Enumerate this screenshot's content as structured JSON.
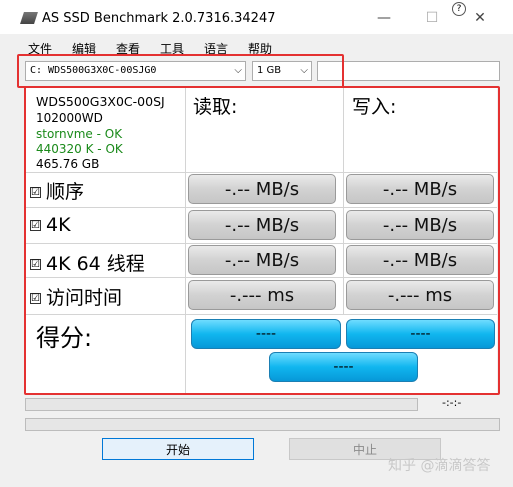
{
  "window": {
    "title": "AS SSD Benchmark 2.0.7316.34247",
    "help_glyph": "?",
    "minimize": "—",
    "maximize": "☐",
    "close": "✕"
  },
  "menu": [
    "文件",
    "编辑",
    "查看",
    "工具",
    "语言",
    "帮助"
  ],
  "toolbar": {
    "drive": "C: WDS500G3X0C-00SJG0",
    "size": "1 GB",
    "extra": ""
  },
  "drive_info": {
    "model": "WDS500G3X0C-00SJ",
    "firmware": "102000WD",
    "driver": "stornvme - OK",
    "alignment": "440320 K - OK",
    "capacity": "465.76 GB",
    "status_color": "#1a8a1a"
  },
  "columns": {
    "read": "读取:",
    "write": "写入:"
  },
  "tests": [
    {
      "label": "顺序",
      "checked": "☑",
      "read": "-.-- MB/s",
      "write": "-.-- MB/s"
    },
    {
      "label": "4K",
      "checked": "☑",
      "read": "-.-- MB/s",
      "write": "-.-- MB/s"
    },
    {
      "label": "4K 64 线程",
      "checked": "☑",
      "read": "-.-- MB/s",
      "write": "-.-- MB/s"
    },
    {
      "label": "访问时间",
      "checked": "☑",
      "read": "-.--- ms",
      "write": "-.--- ms"
    }
  ],
  "score": {
    "label": "得分:",
    "read": "----",
    "write": "----",
    "total": "----"
  },
  "progress": {
    "time": "-:-:-",
    "value": 0
  },
  "buttons": {
    "start": "开始",
    "stop": "中止"
  },
  "watermark": "知乎 @滴滴答答",
  "colors": {
    "highlight": "#e43131",
    "score_blue": "#10b6ef"
  }
}
